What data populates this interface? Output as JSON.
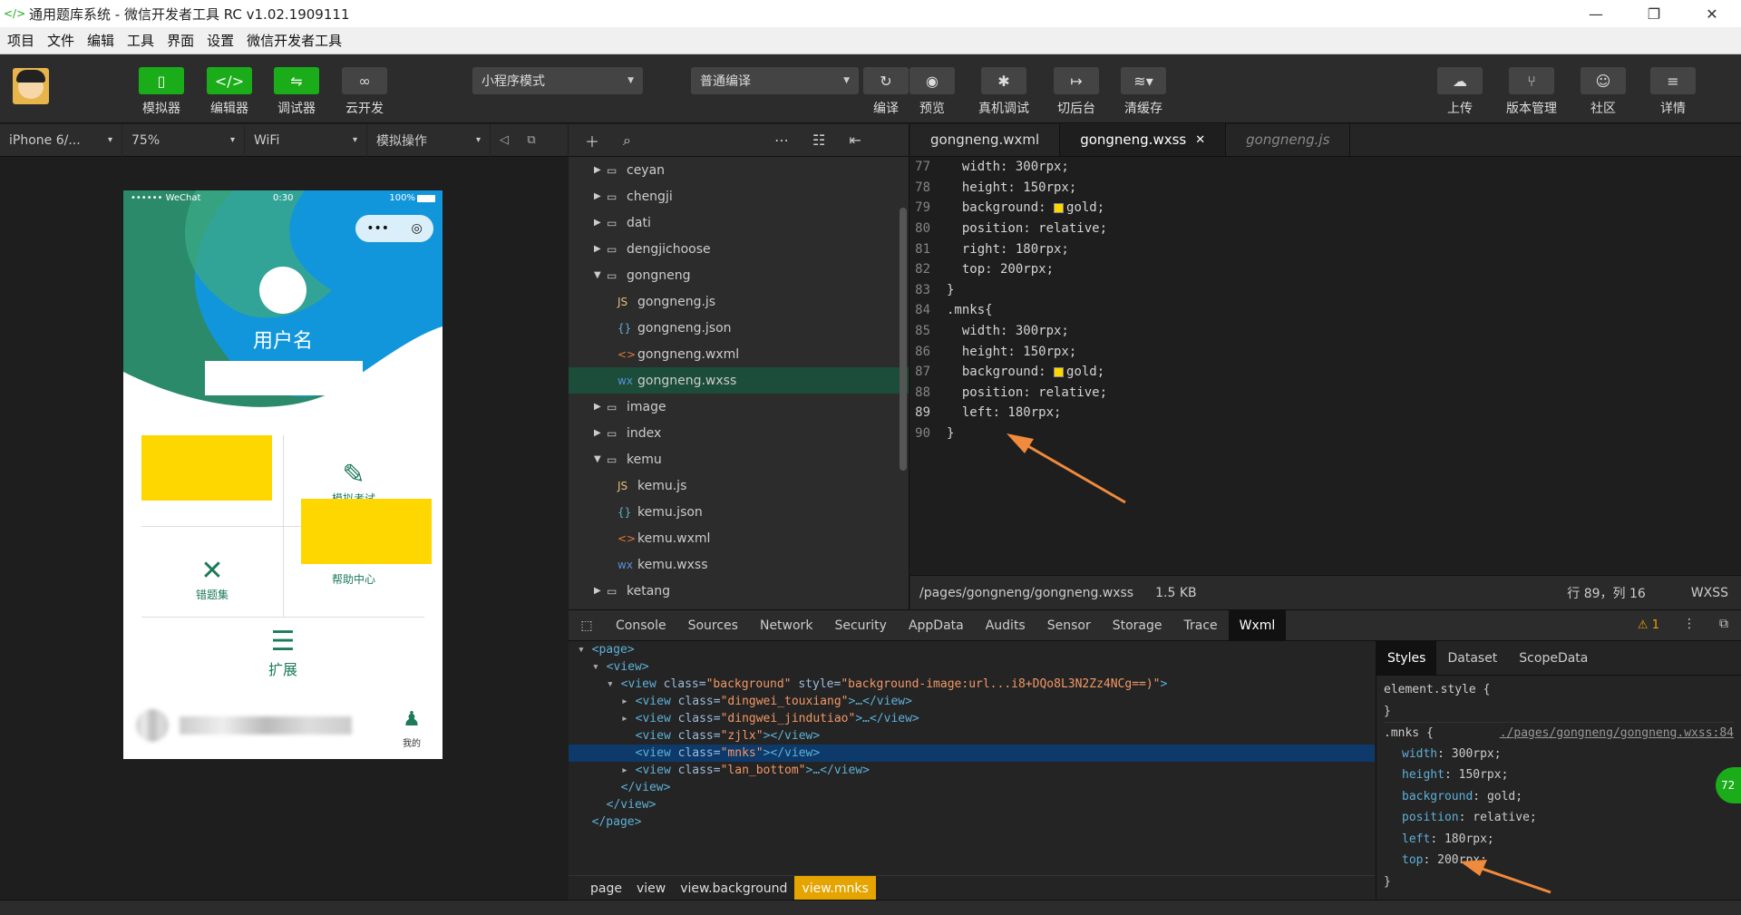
{
  "titlebar": {
    "title": "通用题库系统 - 微信开发者工具 RC v1.02.1909111",
    "minimize": "—",
    "restore": "❐",
    "close": "✕"
  },
  "menu": [
    "项目",
    "文件",
    "编辑",
    "工具",
    "界面",
    "设置",
    "微信开发者工具"
  ],
  "toolbar": {
    "simulator": "模拟器",
    "editor": "编辑器",
    "debugger": "调试器",
    "cloud": "云开发",
    "mode": "小程序模式",
    "compile_mode": "普通编译",
    "compile": "编译",
    "preview": "预览",
    "remote_debug": "真机调试",
    "background": "切后台",
    "clear_cache": "清缓存",
    "upload": "上传",
    "version": "版本管理",
    "community": "社区",
    "details": "详情"
  },
  "devbar": {
    "device": "iPhone 6/...",
    "zoom": "75%",
    "network": "WiFi",
    "simulate": "模拟操作"
  },
  "phone": {
    "carrier": "•••••• WeChat",
    "time": "0:30",
    "battery": "100%",
    "username": "用户名",
    "mock_exam": "模拟考试",
    "wrong_set": "错题集",
    "help_center": "帮助中心",
    "extend": "扩展",
    "mine": "我的"
  },
  "tree": [
    {
      "label": "ceyan",
      "type": "folder",
      "depth": 0,
      "open": false
    },
    {
      "label": "chengji",
      "type": "folder",
      "depth": 0,
      "open": false
    },
    {
      "label": "dati",
      "type": "folder",
      "depth": 0,
      "open": false
    },
    {
      "label": "dengjichoose",
      "type": "folder",
      "depth": 0,
      "open": false
    },
    {
      "label": "gongneng",
      "type": "folder",
      "depth": 0,
      "open": true
    },
    {
      "label": "gongneng.js",
      "type": "js",
      "depth": 1
    },
    {
      "label": "gongneng.json",
      "type": "json",
      "depth": 1
    },
    {
      "label": "gongneng.wxml",
      "type": "wxml",
      "depth": 1
    },
    {
      "label": "gongneng.wxss",
      "type": "wxss",
      "depth": 1,
      "selected": true
    },
    {
      "label": "image",
      "type": "folder",
      "depth": 0,
      "open": false
    },
    {
      "label": "index",
      "type": "folder",
      "depth": 0,
      "open": false
    },
    {
      "label": "kemu",
      "type": "folder",
      "depth": 0,
      "open": true
    },
    {
      "label": "kemu.js",
      "type": "js",
      "depth": 1
    },
    {
      "label": "kemu.json",
      "type": "json",
      "depth": 1
    },
    {
      "label": "kemu.wxml",
      "type": "wxml",
      "depth": 1
    },
    {
      "label": "kemu.wxss",
      "type": "wxss",
      "depth": 1
    },
    {
      "label": "ketang",
      "type": "folder",
      "depth": 0,
      "open": false
    }
  ],
  "editor_tabs": [
    {
      "label": "gongneng.wxml",
      "state": "normal"
    },
    {
      "label": "gongneng.wxss",
      "state": "active"
    },
    {
      "label": "gongneng.js",
      "state": "preview"
    }
  ],
  "code_lines": [
    {
      "n": "77",
      "text": "  width: 300rpx;"
    },
    {
      "n": "78",
      "text": "  height: 150rpx;"
    },
    {
      "n": "79",
      "text": "  background: gold;",
      "swatch": true
    },
    {
      "n": "80",
      "text": "  position: relative;"
    },
    {
      "n": "81",
      "text": "  right: 180rpx;"
    },
    {
      "n": "82",
      "text": "  top: 200rpx;"
    },
    {
      "n": "83",
      "text": "}"
    },
    {
      "n": "84",
      "text": ".mnks{"
    },
    {
      "n": "85",
      "text": "  width: 300rpx;"
    },
    {
      "n": "86",
      "text": "  height: 150rpx;"
    },
    {
      "n": "87",
      "text": "  background: gold;",
      "swatch": true
    },
    {
      "n": "88",
      "text": "  position: relative;"
    },
    {
      "n": "89",
      "text": "  left: 180rpx;",
      "current": true
    },
    {
      "n": "90",
      "text": "}"
    }
  ],
  "editor_status": {
    "path": "/pages/gongneng/gongneng.wxss",
    "size": "1.5 KB",
    "cursor": "行 89，列 16",
    "lang": "WXSS"
  },
  "devtools_tabs": [
    "Console",
    "Sources",
    "Network",
    "Security",
    "AppData",
    "Audits",
    "Sensor",
    "Storage",
    "Trace",
    "Wxml"
  ],
  "devtools_active": "Wxml",
  "warnings": "1",
  "xml_lines": [
    {
      "indent": 0,
      "arrow": "▾",
      "tag": "<page>",
      "attrs": []
    },
    {
      "indent": 1,
      "arrow": "▾",
      "tag": "<view>",
      "attrs": []
    },
    {
      "indent": 2,
      "arrow": "▾",
      "tag": "<view",
      "attrs": [
        {
          "n": "class",
          "v": "\"background\""
        },
        {
          "n": "style",
          "v": "\"background-image:url...i8+DQo8L3N2Zz4NCg==)\""
        }
      ],
      "close": ">"
    },
    {
      "indent": 3,
      "arrow": "▸",
      "tag": "<view",
      "attrs": [
        {
          "n": "class",
          "v": "\"dingwei_touxiang\""
        }
      ],
      "close": ">…</view>"
    },
    {
      "indent": 3,
      "arrow": "▸",
      "tag": "<view",
      "attrs": [
        {
          "n": "class",
          "v": "\"dingwei_jindutiao\""
        }
      ],
      "close": ">…</view>"
    },
    {
      "indent": 3,
      "arrow": " ",
      "tag": "<view",
      "attrs": [
        {
          "n": "class",
          "v": "\"zjlx\""
        }
      ],
      "close": "></view>"
    },
    {
      "indent": 3,
      "arrow": " ",
      "tag": "<view",
      "attrs": [
        {
          "n": "class",
          "v": "\"mnks\""
        }
      ],
      "close": "></view>",
      "selected": true
    },
    {
      "indent": 3,
      "arrow": "▸",
      "tag": "<view",
      "attrs": [
        {
          "n": "class",
          "v": "\"lan_bottom\""
        }
      ],
      "close": ">…</view>"
    },
    {
      "indent": 2,
      "arrow": " ",
      "tag": "</view>",
      "attrs": []
    },
    {
      "indent": 1,
      "arrow": " ",
      "tag": "</view>",
      "attrs": []
    },
    {
      "indent": 0,
      "arrow": " ",
      "tag": "</page>",
      "attrs": []
    }
  ],
  "breadcrumbs": [
    "page",
    "view",
    "view.background",
    "view.mnks"
  ],
  "styles_tabs": [
    "Styles",
    "Dataset",
    "ScopeData"
  ],
  "styles": {
    "element_style": "element.style {",
    "element_close": "}",
    "rule_selector": ".mnks {",
    "rule_source": "./pages/gongneng/gongneng.wxss:84",
    "props": [
      {
        "p": "width",
        "v": "300rpx;"
      },
      {
        "p": "height",
        "v": "150rpx;"
      },
      {
        "p": "background",
        "v": "gold;"
      },
      {
        "p": "position",
        "v": "relative;"
      },
      {
        "p": "left",
        "v": "180rpx;"
      },
      {
        "p": "top",
        "v": "200rpx;"
      }
    ],
    "rule_close": "}"
  },
  "badge": "72",
  "colors": {
    "accent": "#1aad19",
    "gold": "#ffd700",
    "arrow": "#f08a3c",
    "phone_blue": "#1296db",
    "phone_green": "#1b7a5a"
  }
}
